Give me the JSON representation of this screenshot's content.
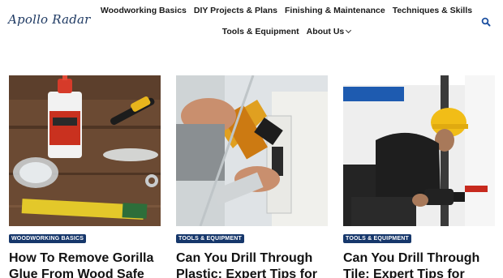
{
  "site": {
    "logo_text": "Apollo Radar"
  },
  "nav": {
    "row1": [
      "Woodworking Basics",
      "DIY Projects & Plans",
      "Finishing & Maintenance",
      "Techniques & Skills"
    ],
    "row2": [
      "Tools & Equipment",
      "About Us"
    ],
    "search_icon": "search-icon",
    "dropdown_icon": "chevron-down-icon"
  },
  "cards": [
    {
      "category": "WOODWORKING BASICS",
      "title": "How To Remove Gorilla Glue From Wood Safe"
    },
    {
      "category": "TOOLS & EQUIPMENT",
      "title": "Can You Drill Through Plastic: Expert Tips for"
    },
    {
      "category": "TOOLS & EQUIPMENT",
      "title": "Can You Drill Through Tile: Expert Tips for"
    }
  ],
  "colors": {
    "accent": "#16376b",
    "logo": "#1f3a63",
    "search": "#1b4fa0"
  }
}
